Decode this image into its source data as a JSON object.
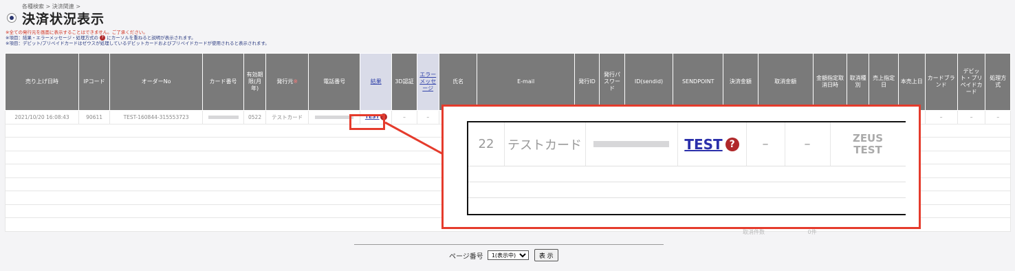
{
  "header": {
    "breadcrumb": "各種検索 > 決済関連 >",
    "title": "決済状況表示"
  },
  "notes": {
    "line1": "※全ての発行元を画面に表示することはできません。ご了承ください。",
    "line2_before": "※項目：結果・エラーメッセージ・処理方式の",
    "line2_after": "にカーソルを重ねると説明が表示されます。",
    "line3": "※項目：デビット/プリペイドカードはゼウスが処理しているデビットカードおよびプリペイドカードが使用されると表示されます。"
  },
  "table": {
    "columns": [
      {
        "label": "売り上げ日時"
      },
      {
        "label": "IPコード"
      },
      {
        "label": "オーダーNo"
      },
      {
        "label": "カード番号"
      },
      {
        "label": "有効期限(月年)"
      },
      {
        "label": "発行元",
        "required": "※"
      },
      {
        "label": "電話番号"
      },
      {
        "label": "結果",
        "link": true
      },
      {
        "label": "3D認証"
      },
      {
        "label": "エラーメッセージ",
        "link": true
      },
      {
        "label": "氏名"
      },
      {
        "label": "E-mail"
      },
      {
        "label": "発行ID"
      },
      {
        "label": "発行パスワード"
      },
      {
        "label": "ID(sendid)"
      },
      {
        "label": "SENDPOINT"
      },
      {
        "label": "決済金額"
      },
      {
        "label": "取消金額"
      },
      {
        "label": "金額指定取消日時"
      },
      {
        "label": "取消種別"
      },
      {
        "label": "売上指定日"
      },
      {
        "label": "本売上日"
      },
      {
        "label": "カードブランド"
      },
      {
        "label": "デビット・プリペイドカード"
      },
      {
        "label": "処理方式"
      }
    ],
    "row": {
      "datetime": "2021/10/20 16:08:43",
      "ipcode": "90611",
      "order_no": "TEST-160844-315553723",
      "expiry": "0522",
      "issuer": "テストカード",
      "result": "TEST",
      "three_d": "–",
      "dash": "–"
    }
  },
  "zoom": {
    "expiry_partial": "22",
    "issuer": "テストカード",
    "result": "TEST",
    "dash": "–",
    "zeus_line1": "ZEUS",
    "zeus_line2": "TEST"
  },
  "footer": {
    "cancel_label": "取消件数",
    "cancel_value": "0件"
  },
  "pager": {
    "label": "ページ番号",
    "selected": "1(表示中)",
    "button": "表 示"
  },
  "colors": {
    "header_bg": "#7a7a7a",
    "highlight": "#e53b2c",
    "link": "#3344aa",
    "help_icon": "#b0282a"
  },
  "icons": {
    "help": "question-circle-icon",
    "radio": "radio-icon"
  }
}
